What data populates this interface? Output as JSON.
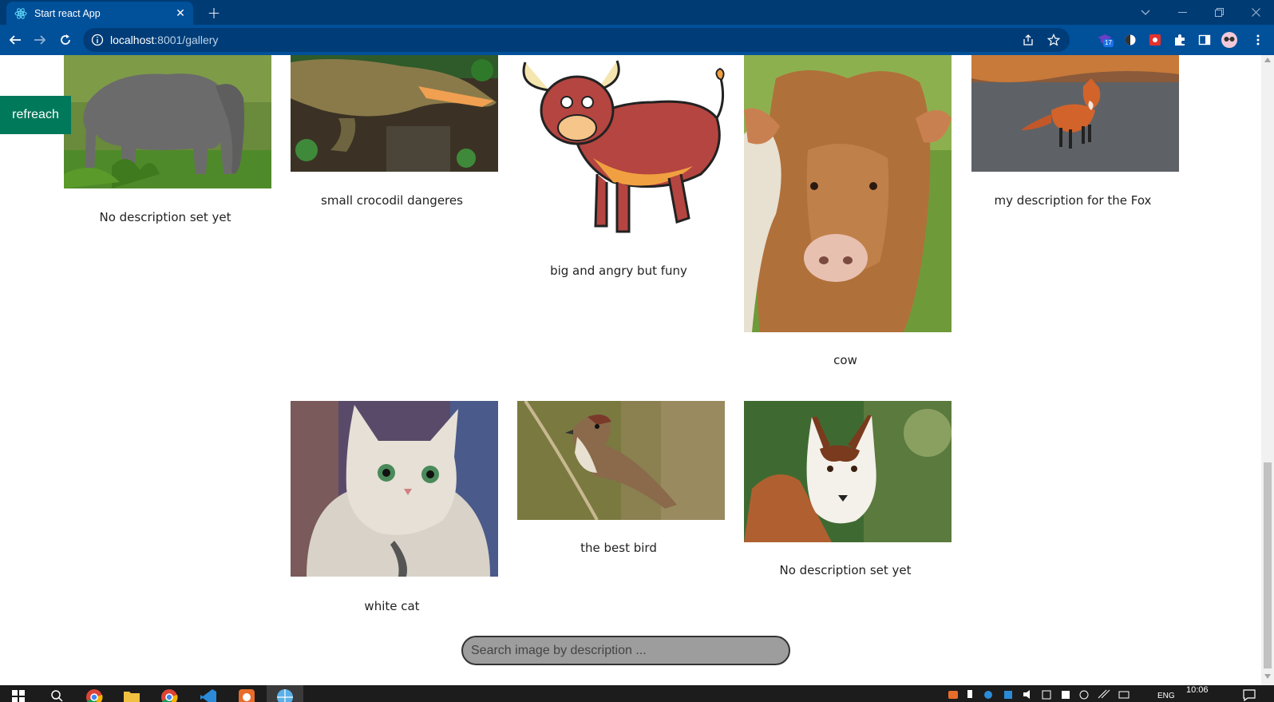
{
  "browser": {
    "tab_title": "Start react App",
    "url_host": "localhost",
    "url_path": ":8001/gallery",
    "extension_badge": "17",
    "theme_color": "#003b73",
    "toolbar_color": "#00509a"
  },
  "page": {
    "refresh_label": "refreach",
    "refresh_color": "#00785a",
    "search_placeholder": "Search image by description ...",
    "gallery": [
      {
        "subject": "elephant",
        "caption": "No description set yet"
      },
      {
        "subject": "crocodile",
        "caption": "small crocodil dangeres"
      },
      {
        "subject": "cartoon-bull",
        "caption": "big and angry but funy"
      },
      {
        "subject": "cow",
        "caption": "cow"
      },
      {
        "subject": "fox",
        "caption": "my description for the Fox"
      },
      {
        "subject": "white-cat",
        "caption": "white cat"
      },
      {
        "subject": "sparrow",
        "caption": "the best bird"
      },
      {
        "subject": "husky",
        "caption": "No description set yet"
      }
    ]
  },
  "taskbar": {
    "clock": "10:06",
    "language": "ENG"
  }
}
